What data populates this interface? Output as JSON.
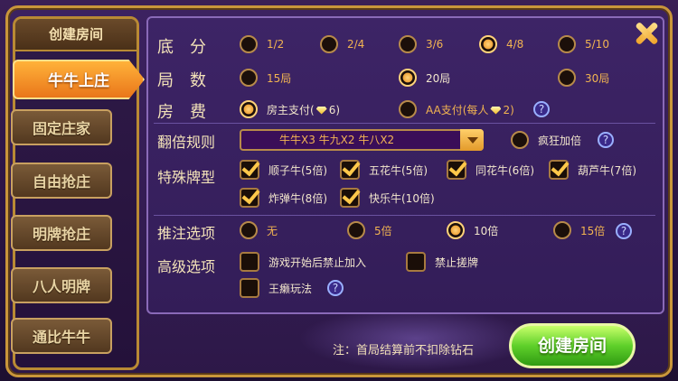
{
  "sidebar": {
    "title": "创建房间",
    "items": [
      {
        "label": "牛牛上庄",
        "active": true
      },
      {
        "label": "固定庄家"
      },
      {
        "label": "自由抢庄"
      },
      {
        "label": "明牌抢庄"
      },
      {
        "label": "八人明牌"
      },
      {
        "label": "通比牛牛"
      }
    ]
  },
  "rows": {
    "base": {
      "label": "底　分",
      "options": [
        "1/2",
        "2/4",
        "3/6",
        "4/8",
        "5/10"
      ],
      "selected": "4/8"
    },
    "rounds": {
      "label": "局　数",
      "options": [
        "15局",
        "20局",
        "30局"
      ],
      "selected": "20局"
    },
    "fee": {
      "label": "房　费",
      "options": [
        {
          "pre": "房主支付(",
          "post": "6)"
        },
        {
          "pre": "AA支付(每人",
          "post": "2)"
        }
      ],
      "selected": 0
    },
    "multiplier": {
      "label": "翻倍规则",
      "select_value": "牛牛X3   牛九X2   牛八X2",
      "extra": "疯狂加倍"
    },
    "special": {
      "label": "特殊牌型",
      "options": [
        "顺子牛(5倍)",
        "五花牛(5倍)",
        "同花牛(6倍)",
        "葫芦牛(7倍)",
        "炸弹牛(8倍)",
        "快乐牛(10倍)"
      ]
    },
    "bet": {
      "label": "推注选项",
      "options": [
        "无",
        "5倍",
        "10倍",
        "15倍"
      ],
      "selected": "10倍"
    },
    "advanced": {
      "label": "高级选项",
      "options": [
        "游戏开始后禁止加入",
        "禁止搓牌",
        "王癞玩法"
      ]
    }
  },
  "footer": {
    "note": "注：首局结算前不扣除钻石",
    "create_button": "创建房间"
  },
  "icons": {
    "help": "?",
    "close": "close-icon"
  }
}
